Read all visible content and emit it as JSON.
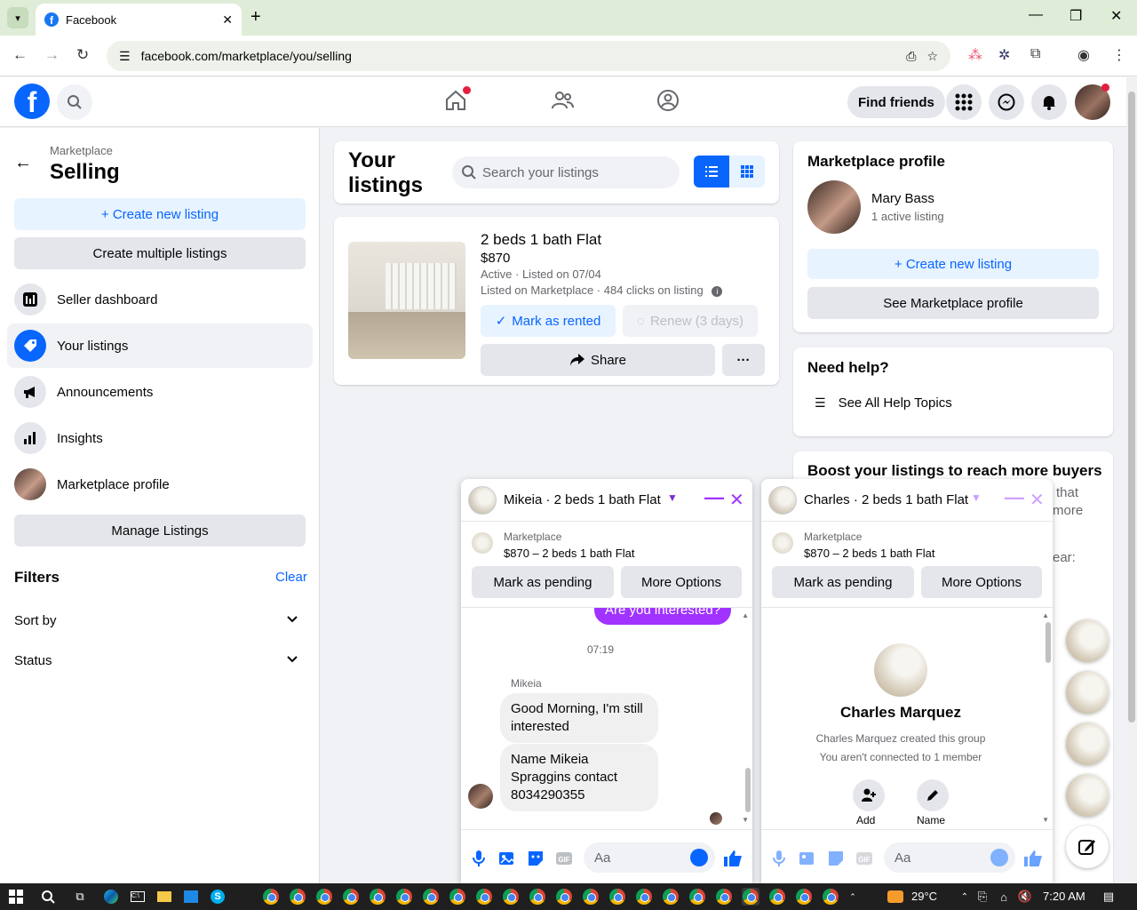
{
  "browser": {
    "tab_title": "Facebook",
    "url": "facebook.com/marketplace/you/selling"
  },
  "header": {
    "find_friends": "Find friends"
  },
  "sidebar": {
    "breadcrumb": "Marketplace",
    "title": "Selling",
    "create_new_listing": "+ Create new listing",
    "create_multiple": "Create multiple listings",
    "items": [
      {
        "label": "Seller dashboard",
        "icon": "dashboard-icon"
      },
      {
        "label": "Your listings",
        "icon": "tag-icon"
      },
      {
        "label": "Announcements",
        "icon": "megaphone-icon"
      },
      {
        "label": "Insights",
        "icon": "bar-chart-icon"
      },
      {
        "label": "Marketplace profile",
        "icon": "avatar"
      }
    ],
    "manage_listings": "Manage Listings",
    "filters": "Filters",
    "clear": "Clear",
    "sort_by": "Sort by",
    "status": "Status"
  },
  "listings": {
    "title": "Your listings",
    "search_placeholder": "Search your listings",
    "item": {
      "title": "2 beds 1 bath Flat",
      "price": "$870",
      "status": "Active · Listed on 07/04",
      "clicks": "Listed on Marketplace · 484 clicks on listing",
      "mark_rented": "Mark as rented",
      "renew": "Renew (3 days)",
      "share": "Share",
      "more": "···"
    }
  },
  "profile": {
    "title": "Marketplace profile",
    "name": "Mary Bass",
    "active": "1 active listing",
    "create_new": "+ Create new listing",
    "see_profile": "See Marketplace profile"
  },
  "help": {
    "title": "Need help?",
    "topics": "See All Help Topics"
  },
  "boost": {
    "title": "Boost your listings to reach more buyers",
    "frag1": "that",
    "frag2": "more",
    "frag3": "ear:"
  },
  "chat1": {
    "name": "Mikeia · 2 beds 1 bath Flat",
    "mp_label": "Marketplace",
    "mp_info": "$870 – 2 beds 1 bath Flat",
    "mark_pending": "Mark as pending",
    "more_options": "More Options",
    "sent": "Are you interested?",
    "time": "07:19",
    "sender": "Mikeia",
    "msg1": "Good Morning, I'm still interested",
    "msg2": "Name Mikeia Spraggins contact 8034290355",
    "placeholder": "Aa"
  },
  "chat2": {
    "name": "Charles · 2 beds 1 bath Flat",
    "mp_label": "Marketplace",
    "mp_info": "$870 – 2 beds 1 bath Flat",
    "mark_pending": "Mark as pending",
    "more_options": "More Options",
    "group_name": "Charles Marquez",
    "created": "Charles Marquez created this group",
    "not_connected": "You aren't connected to 1 member",
    "add": "Add",
    "name_label": "Name",
    "placeholder": "Aa"
  },
  "taskbar": {
    "temp": "29°C",
    "time": "7:20 AM"
  }
}
